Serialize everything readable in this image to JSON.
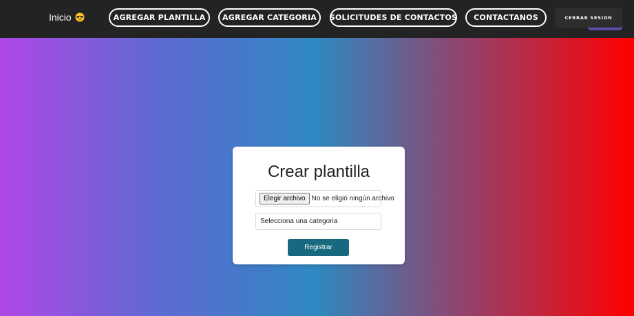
{
  "nav": {
    "home_label": "Inicio",
    "home_icon": "sunglasses-emoji-icon",
    "items": [
      {
        "label": "AGREGAR PLANTILLA"
      },
      {
        "label": "AGREGAR CATEGORIA"
      },
      {
        "label": "SOLICITUDES DE CONTACTOS"
      },
      {
        "label": "CONTACTANOS"
      }
    ],
    "logout_label": "CERRAR SESION"
  },
  "colors": {
    "navbar_bg": "#232323",
    "gradient": [
      "#b047e6",
      "#5e6ad2",
      "#2f88c1",
      "#9a3d66",
      "#ff0000"
    ],
    "submit_bg": "#16697f"
  },
  "form": {
    "title": "Crear plantilla",
    "file_button_label": "Elegir archivo",
    "file_status": "No se eligió ningún archivo",
    "category_placeholder": "Selecciona una categoria",
    "submit_label": "Registrar"
  }
}
